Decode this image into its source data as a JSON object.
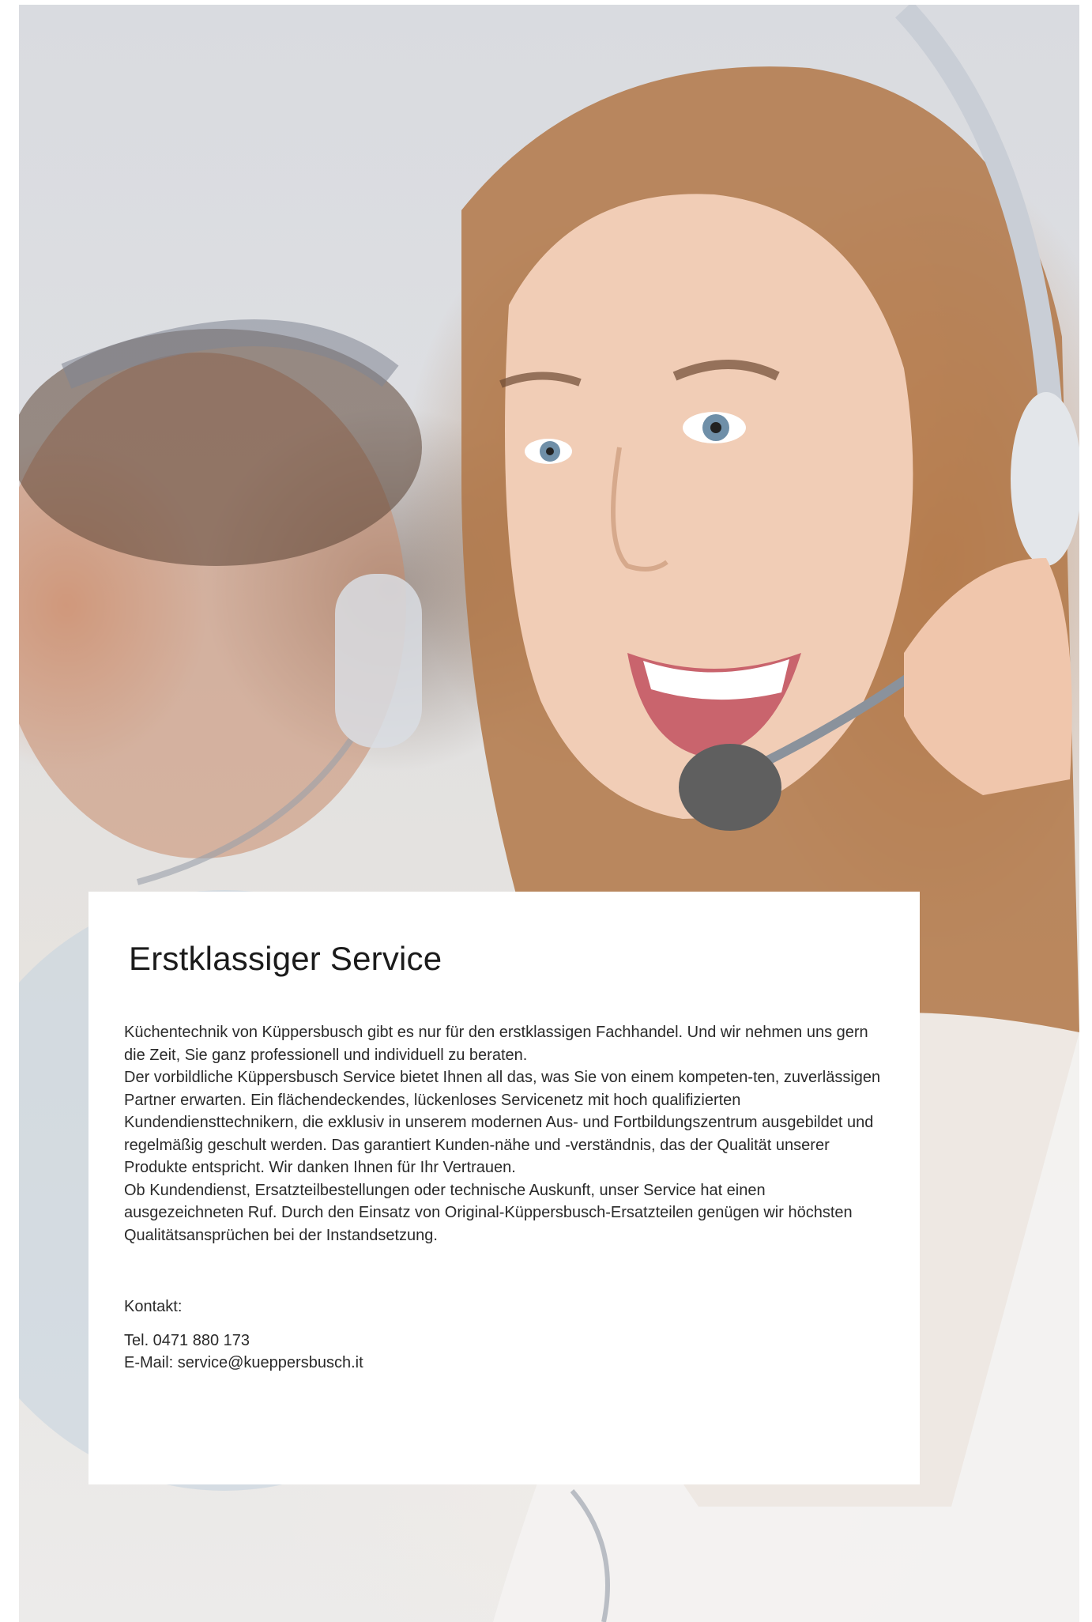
{
  "article": {
    "title": "Erstklassiger Service",
    "paragraphs": [
      "Küchentechnik von Küppersbusch gibt es nur für den erstklassigen Fachhandel. Und wir nehmen uns gern die Zeit, Sie ganz professionell und individuell zu beraten.",
      "Der vorbildliche Küppersbusch Service bietet Ihnen all das, was Sie von einem kompeten-ten, zuverlässigen Partner erwarten. Ein flächendeckendes, lückenloses Servicenetz mit hoch qualifizierten Kundendiensttechnikern, die exklusiv in unserem modernen Aus- und Fortbildungszentrum ausgebildet und regelmäßig geschult werden. Das garantiert Kunden-nähe und -verständnis, das der Qualität unserer Produkte entspricht. Wir danken Ihnen für Ihr Vertrauen.",
      "Ob Kundendienst, Ersatzteilbestellungen oder technische Auskunft, unser Service hat einen ausgezeichneten Ruf. Durch den Einsatz von Original-Küppersbusch-Ersatzteilen genügen wir höchsten Qualitätsansprüchen bei der Instandsetzung."
    ]
  },
  "contact": {
    "label": "Kontakt:",
    "phone": "Tel. 0471 880 173",
    "email": "E-Mail: service@kueppersbusch.it"
  },
  "photo": {
    "subject": "call-center-agents-with-headsets"
  },
  "colors": {
    "card_background": "#ffffff",
    "text": "#2a2a2a",
    "heading": "#1b1b1b"
  }
}
